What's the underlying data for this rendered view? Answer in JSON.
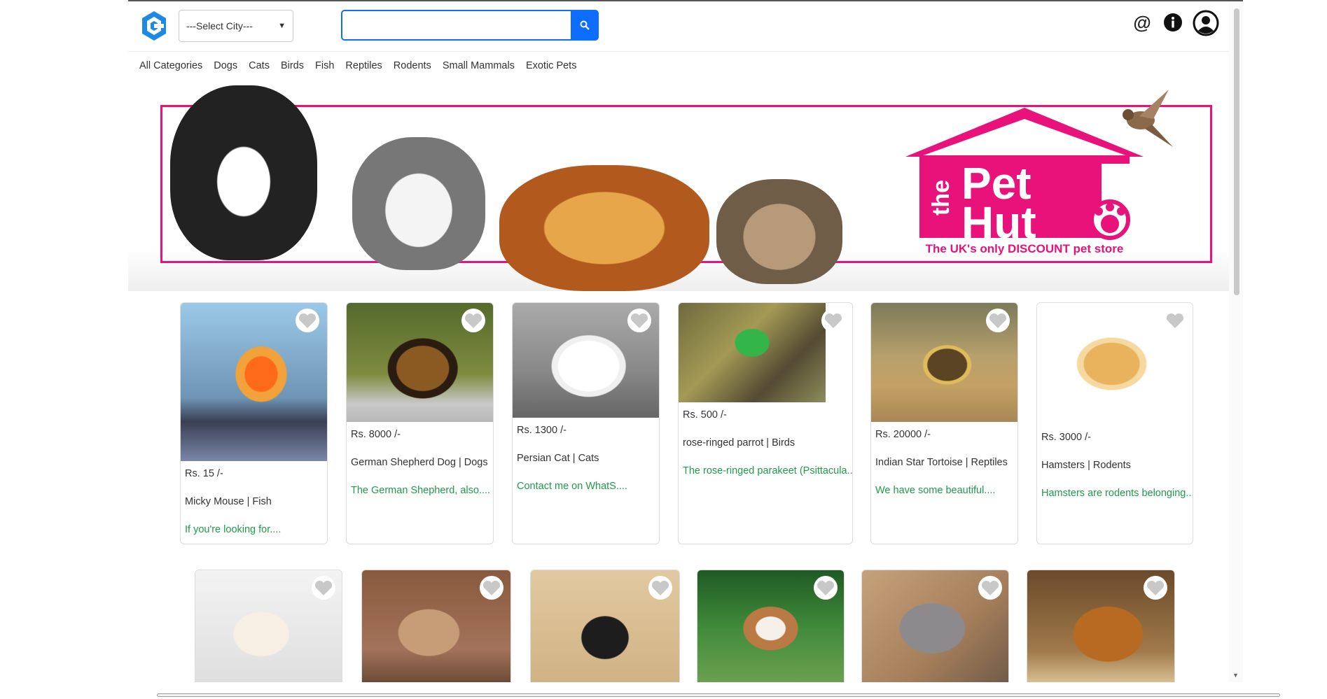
{
  "header": {
    "city_select": "---Select City---",
    "search_placeholder": ""
  },
  "categories": [
    "All Categories",
    "Dogs",
    "Cats",
    "Birds",
    "Fish",
    "Reptiles",
    "Rodents",
    "Small Mammals",
    "Exotic Pets"
  ],
  "banner": {
    "brand_small": "the",
    "brand_big_1": "Pet",
    "brand_big_2": "Hut",
    "tagline": "The UK's only DISCOUNT pet store"
  },
  "products": [
    {
      "price": "Rs. 15 /-",
      "name": "Micky Mouse | Fish",
      "desc": "If you're looking for...."
    },
    {
      "price": "Rs. 8000 /-",
      "name": "German Shepherd Dog | Dogs",
      "desc": "The German Shepherd, also...."
    },
    {
      "price": "Rs. 1300 /-",
      "name": "Persian Cat | Cats",
      "desc": "Contact me on WhatS...."
    },
    {
      "price": "Rs. 500 /-",
      "name": "rose-ringed parrot | Birds",
      "desc": "The rose-ringed parakeet (Psittacula...."
    },
    {
      "price": "Rs. 20000 /-",
      "name": "Indian Star Tortoise | Reptiles",
      "desc": "We have some beautiful...."
    },
    {
      "price": "Rs. 3000 /-",
      "name": "Hamsters | Rodents",
      "desc": "Hamsters are rodents belonging...."
    }
  ],
  "colors": {
    "accent": "#0d6efd",
    "brand": "#e8127a",
    "desc_text": "#1f9b4a"
  }
}
